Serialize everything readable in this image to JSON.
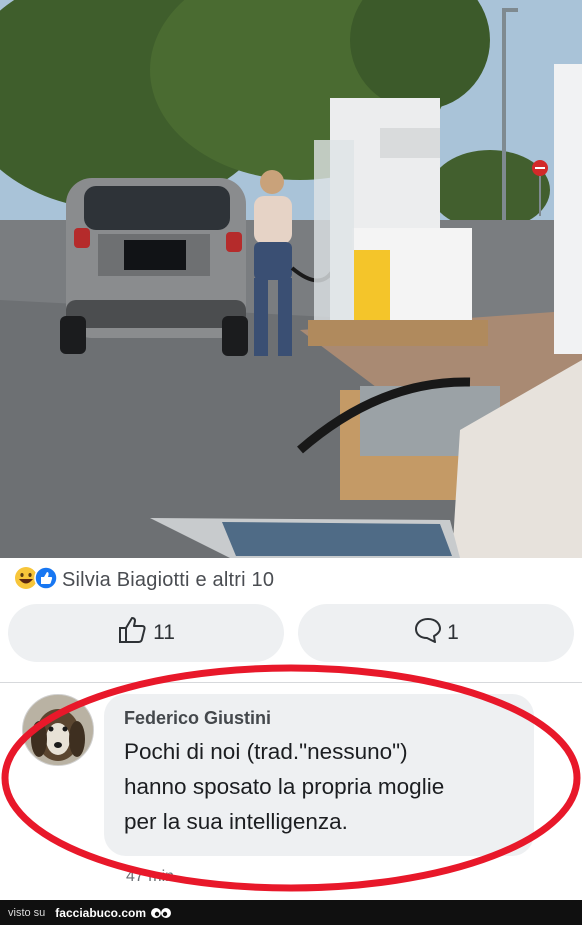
{
  "reactions": {
    "names_text": "Silvia Biagiotti e altri 10",
    "emoji_icons": [
      "laughing-emoji-icon",
      "like-icon"
    ]
  },
  "actions": {
    "like_count": "11",
    "comment_count": "1"
  },
  "comment": {
    "author": "Federico Giustini",
    "lines": [
      "Pochi di noi (trad.\"nessuno\")",
      "hanno sposato la propria moglie",
      "per la sua intelligenza."
    ],
    "timestamp": "47 min"
  },
  "footer": {
    "visto_label": "visto su",
    "site": "facciabuco.com"
  },
  "colors": {
    "like_blue": "#1877f2",
    "annotation_red": "#e8182a",
    "pill_bg": "#eef0f2"
  }
}
